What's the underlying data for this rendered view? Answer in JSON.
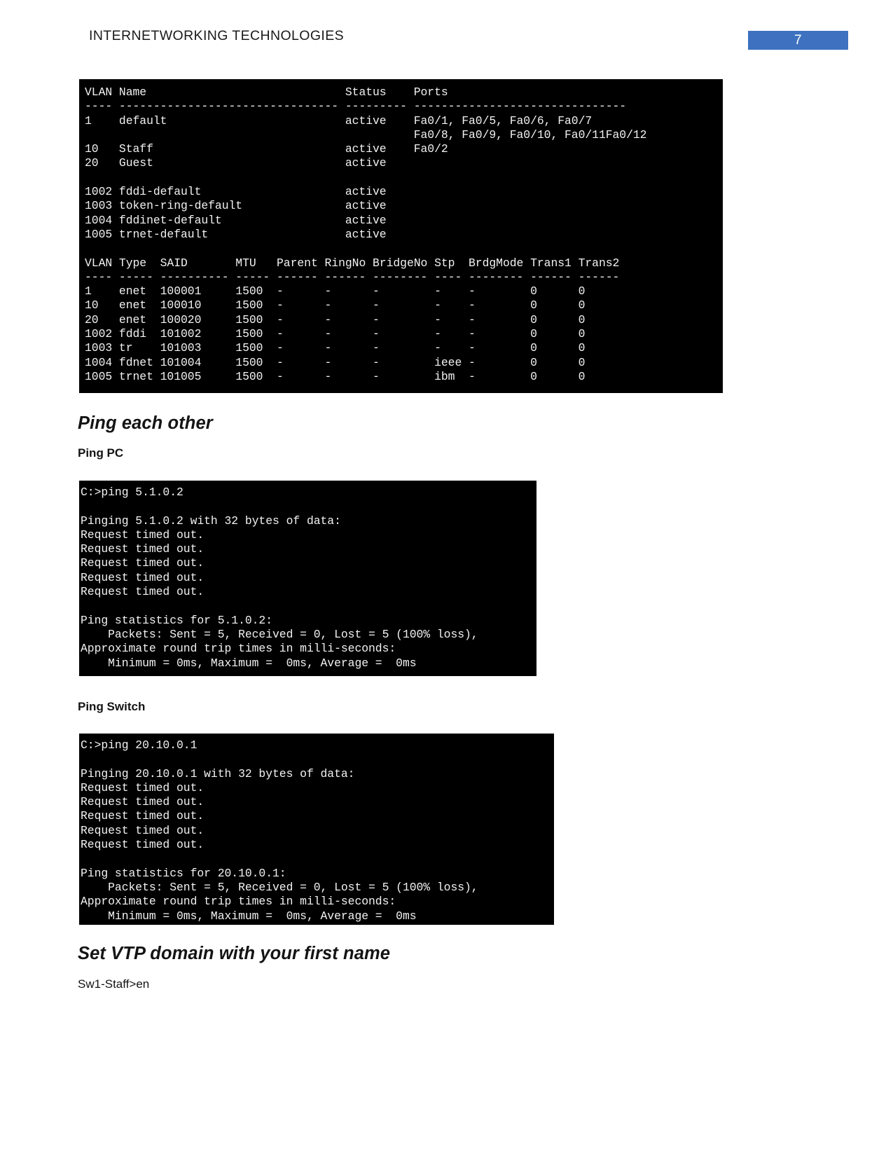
{
  "header": {
    "title": "INTERNETWORKING TECHNOLOGIES",
    "page_number": "7",
    "badge_color": "#3e72c0"
  },
  "terminals": {
    "vlan_table": {
      "name": "show vlan output",
      "background": "#000000",
      "foreground": "#f2f2f2",
      "lines": [
        "VLAN Name                             Status    Ports",
        "---- -------------------------------- --------- -------------------------------",
        "1    default                          active    Fa0/1, Fa0/5, Fa0/6, Fa0/7",
        "                                                Fa0/8, Fa0/9, Fa0/10, Fa0/11Fa0/12",
        "10   Staff                            active    Fa0/2",
        "20   Guest                            active",
        "",
        "1002 fddi-default                     active",
        "1003 token-ring-default               active",
        "1004 fddinet-default                  active",
        "1005 trnet-default                    active",
        "",
        "VLAN Type  SAID       MTU   Parent RingNo BridgeNo Stp  BrdgMode Trans1 Trans2",
        "---- ----- ---------- ----- ------ ------ -------- ---- -------- ------ ------",
        "1    enet  100001     1500  -      -      -        -    -        0      0",
        "10   enet  100010     1500  -      -      -        -    -        0      0",
        "20   enet  100020     1500  -      -      -        -    -        0      0",
        "1002 fddi  101002     1500  -      -      -        -    -        0      0",
        "1003 tr    101003     1500  -      -      -        -    -        0      0",
        "1004 fdnet 101004     1500  -      -      -        ieee -        0      0",
        "1005 trnet 101005     1500  -      -      -        ibm  -        0      0"
      ]
    },
    "ping_pc": {
      "name": "ping 5.1.0.2 output",
      "background": "#000000",
      "foreground": "#f2f2f2",
      "lines": [
        "C:>ping 5.1.0.2",
        "",
        "Pinging 5.1.0.2 with 32 bytes of data:",
        "Request timed out.",
        "Request timed out.",
        "Request timed out.",
        "Request timed out.",
        "Request timed out.",
        "",
        "Ping statistics for 5.1.0.2:",
        "    Packets: Sent = 5, Received = 0, Lost = 5 (100% loss),",
        "Approximate round trip times in milli-seconds:",
        "    Minimum = 0ms, Maximum =  0ms, Average =  0ms"
      ]
    },
    "ping_switch": {
      "name": "ping 20.10.0.1 output",
      "background": "#000000",
      "foreground": "#f2f2f2",
      "lines": [
        "C:>ping 20.10.0.1",
        "",
        "Pinging 20.10.0.1 with 32 bytes of data:",
        "Request timed out.",
        "Request timed out.",
        "Request timed out.",
        "Request timed out.",
        "Request timed out.",
        "",
        "Ping statistics for 20.10.0.1:",
        "    Packets: Sent = 5, Received = 0, Lost = 5 (100% loss),",
        "Approximate round trip times in milli-seconds:",
        "    Minimum = 0ms, Maximum =  0ms, Average =  0ms"
      ]
    }
  },
  "content": {
    "heading_ping_each_other": "Ping each other",
    "label_ping_pc": "Ping PC",
    "label_ping_switch": "Ping Switch",
    "heading_set_vtp": "Set VTP domain with your first name",
    "text_sw1_staff": "Sw1-Staff>en"
  }
}
